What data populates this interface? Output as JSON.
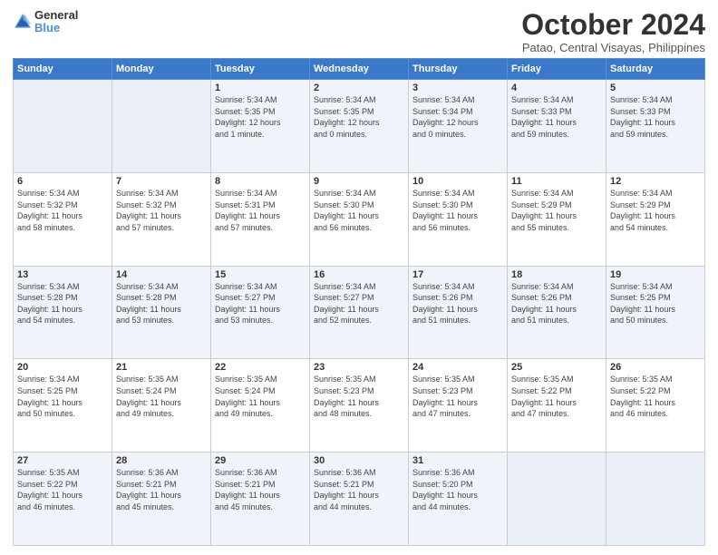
{
  "logo": {
    "general": "General",
    "blue": "Blue"
  },
  "title": "October 2024",
  "location": "Patao, Central Visayas, Philippines",
  "weekdays": [
    "Sunday",
    "Monday",
    "Tuesday",
    "Wednesday",
    "Thursday",
    "Friday",
    "Saturday"
  ],
  "weeks": [
    [
      {
        "day": "",
        "info": ""
      },
      {
        "day": "",
        "info": ""
      },
      {
        "day": "1",
        "info": "Sunrise: 5:34 AM\nSunset: 5:35 PM\nDaylight: 12 hours\nand 1 minute."
      },
      {
        "day": "2",
        "info": "Sunrise: 5:34 AM\nSunset: 5:35 PM\nDaylight: 12 hours\nand 0 minutes."
      },
      {
        "day": "3",
        "info": "Sunrise: 5:34 AM\nSunset: 5:34 PM\nDaylight: 12 hours\nand 0 minutes."
      },
      {
        "day": "4",
        "info": "Sunrise: 5:34 AM\nSunset: 5:33 PM\nDaylight: 11 hours\nand 59 minutes."
      },
      {
        "day": "5",
        "info": "Sunrise: 5:34 AM\nSunset: 5:33 PM\nDaylight: 11 hours\nand 59 minutes."
      }
    ],
    [
      {
        "day": "6",
        "info": "Sunrise: 5:34 AM\nSunset: 5:32 PM\nDaylight: 11 hours\nand 58 minutes."
      },
      {
        "day": "7",
        "info": "Sunrise: 5:34 AM\nSunset: 5:32 PM\nDaylight: 11 hours\nand 57 minutes."
      },
      {
        "day": "8",
        "info": "Sunrise: 5:34 AM\nSunset: 5:31 PM\nDaylight: 11 hours\nand 57 minutes."
      },
      {
        "day": "9",
        "info": "Sunrise: 5:34 AM\nSunset: 5:30 PM\nDaylight: 11 hours\nand 56 minutes."
      },
      {
        "day": "10",
        "info": "Sunrise: 5:34 AM\nSunset: 5:30 PM\nDaylight: 11 hours\nand 56 minutes."
      },
      {
        "day": "11",
        "info": "Sunrise: 5:34 AM\nSunset: 5:29 PM\nDaylight: 11 hours\nand 55 minutes."
      },
      {
        "day": "12",
        "info": "Sunrise: 5:34 AM\nSunset: 5:29 PM\nDaylight: 11 hours\nand 54 minutes."
      }
    ],
    [
      {
        "day": "13",
        "info": "Sunrise: 5:34 AM\nSunset: 5:28 PM\nDaylight: 11 hours\nand 54 minutes."
      },
      {
        "day": "14",
        "info": "Sunrise: 5:34 AM\nSunset: 5:28 PM\nDaylight: 11 hours\nand 53 minutes."
      },
      {
        "day": "15",
        "info": "Sunrise: 5:34 AM\nSunset: 5:27 PM\nDaylight: 11 hours\nand 53 minutes."
      },
      {
        "day": "16",
        "info": "Sunrise: 5:34 AM\nSunset: 5:27 PM\nDaylight: 11 hours\nand 52 minutes."
      },
      {
        "day": "17",
        "info": "Sunrise: 5:34 AM\nSunset: 5:26 PM\nDaylight: 11 hours\nand 51 minutes."
      },
      {
        "day": "18",
        "info": "Sunrise: 5:34 AM\nSunset: 5:26 PM\nDaylight: 11 hours\nand 51 minutes."
      },
      {
        "day": "19",
        "info": "Sunrise: 5:34 AM\nSunset: 5:25 PM\nDaylight: 11 hours\nand 50 minutes."
      }
    ],
    [
      {
        "day": "20",
        "info": "Sunrise: 5:34 AM\nSunset: 5:25 PM\nDaylight: 11 hours\nand 50 minutes."
      },
      {
        "day": "21",
        "info": "Sunrise: 5:35 AM\nSunset: 5:24 PM\nDaylight: 11 hours\nand 49 minutes."
      },
      {
        "day": "22",
        "info": "Sunrise: 5:35 AM\nSunset: 5:24 PM\nDaylight: 11 hours\nand 49 minutes."
      },
      {
        "day": "23",
        "info": "Sunrise: 5:35 AM\nSunset: 5:23 PM\nDaylight: 11 hours\nand 48 minutes."
      },
      {
        "day": "24",
        "info": "Sunrise: 5:35 AM\nSunset: 5:23 PM\nDaylight: 11 hours\nand 47 minutes."
      },
      {
        "day": "25",
        "info": "Sunrise: 5:35 AM\nSunset: 5:22 PM\nDaylight: 11 hours\nand 47 minutes."
      },
      {
        "day": "26",
        "info": "Sunrise: 5:35 AM\nSunset: 5:22 PM\nDaylight: 11 hours\nand 46 minutes."
      }
    ],
    [
      {
        "day": "27",
        "info": "Sunrise: 5:35 AM\nSunset: 5:22 PM\nDaylight: 11 hours\nand 46 minutes."
      },
      {
        "day": "28",
        "info": "Sunrise: 5:36 AM\nSunset: 5:21 PM\nDaylight: 11 hours\nand 45 minutes."
      },
      {
        "day": "29",
        "info": "Sunrise: 5:36 AM\nSunset: 5:21 PM\nDaylight: 11 hours\nand 45 minutes."
      },
      {
        "day": "30",
        "info": "Sunrise: 5:36 AM\nSunset: 5:21 PM\nDaylight: 11 hours\nand 44 minutes."
      },
      {
        "day": "31",
        "info": "Sunrise: 5:36 AM\nSunset: 5:20 PM\nDaylight: 11 hours\nand 44 minutes."
      },
      {
        "day": "",
        "info": ""
      },
      {
        "day": "",
        "info": ""
      }
    ]
  ]
}
